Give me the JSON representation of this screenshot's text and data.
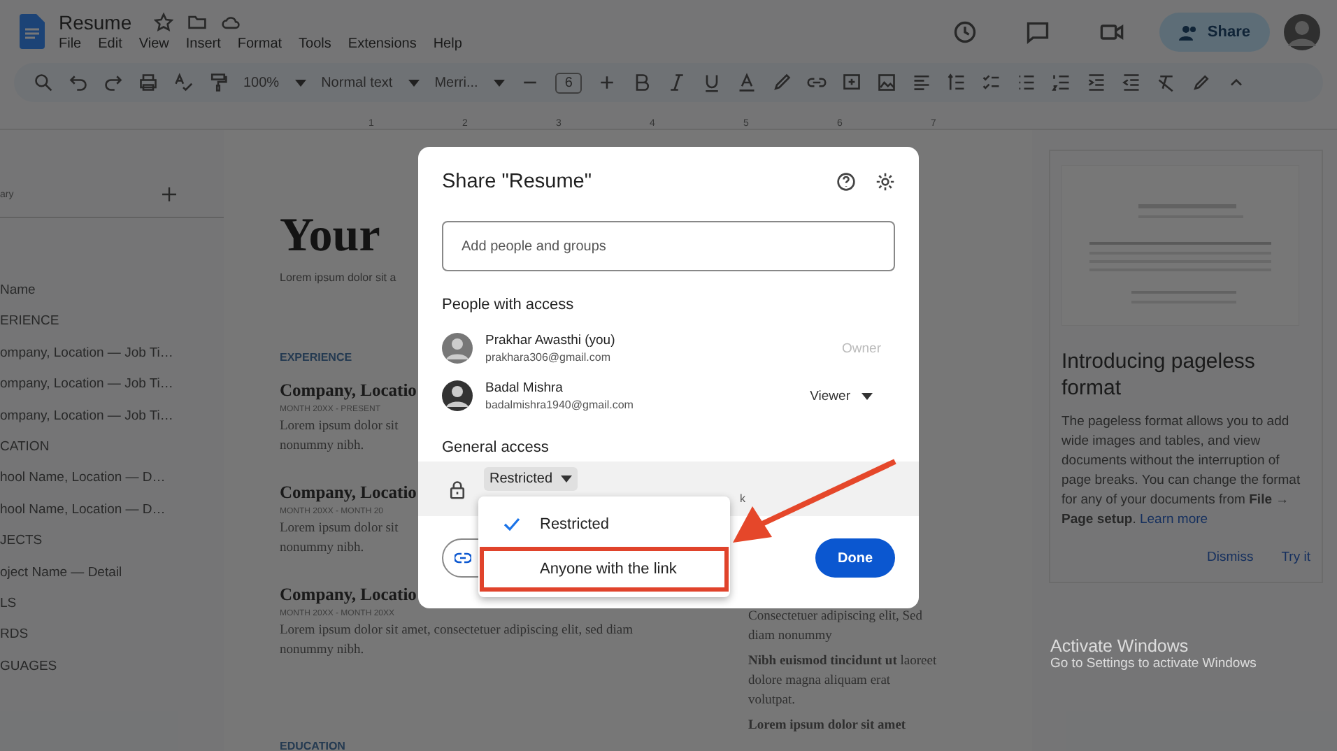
{
  "app": {
    "title": "Resume",
    "menus": [
      "File",
      "Edit",
      "View",
      "Insert",
      "Format",
      "Tools",
      "Extensions",
      "Help"
    ],
    "share_label": "Share"
  },
  "toolbar": {
    "zoom": "100%",
    "style": "Normal text",
    "font": "Merri...",
    "font_size": "6"
  },
  "ruler": {
    "numbers": [
      "1",
      "2",
      "3",
      "4",
      "5",
      "6",
      "7"
    ]
  },
  "outline": {
    "heading": "ary",
    "items": [
      "Name",
      "ERIENCE",
      "ompany, Location — Job Ti…",
      "ompany, Location — Job Ti…",
      "ompany, Location — Job Ti…",
      "CATION",
      "hool Name, Location — D…",
      "hool Name, Location — D…",
      "JECTS",
      "oject Name — Detail",
      "LS",
      "RDS",
      "GUAGES"
    ]
  },
  "document": {
    "title": "Your",
    "intro": "Lorem ipsum dolor sit a",
    "sections": [
      {
        "heading": "EXPERIENCE",
        "entries": [
          {
            "title": "Company, Locatio",
            "date": "MONTH 20XX - PRESENT",
            "body": [
              "Lorem ipsum dolor sit",
              "nonummy nibh."
            ]
          },
          {
            "title": "Company, Locatio",
            "date": "MONTH 20XX - MONTH 20",
            "body": [
              "Lorem ipsum dolor sit",
              "nonummy nibh."
            ]
          },
          {
            "title": "Company, Locatio",
            "date": "MONTH 20XX - MONTH 20XX",
            "body": [
              "Lorem ipsum dolor sit amet, consectetuer adipiscing elit, sed diam",
              "nonummy nibh."
            ]
          }
        ]
      },
      {
        "heading": "EDUCATION"
      }
    ],
    "side_column": [
      "Consectetuer adipiscing elit, Sed diam nonummy",
      "**Nibh euismod tincidunt ut** laoreet dolore magna aliquam erat volutpat.",
      "**Lorem ipsum dolor sit amet**"
    ]
  },
  "promo": {
    "title": "Introducing pageless format",
    "body": "The pageless format allows you to add wide images and tables, and view documents without the interruption of page breaks. You can change the format for any of your documents from **File → Page setup**.",
    "link": "Learn more",
    "actions": [
      "Dismiss",
      "Try it"
    ]
  },
  "system_notice": {
    "title": "Activate Windows",
    "subtitle": "Go to Settings to activate Windows"
  },
  "dialog": {
    "title": "Share \"Resume\"",
    "search": {
      "placeholder": "Add people and groups"
    },
    "people_heading": "People with access",
    "people": [
      {
        "name": "Prakhar Awasthi (you)",
        "email": "prakhara306@gmail.com",
        "role": "Owner",
        "editable": false
      },
      {
        "name": "Badal Mishra",
        "email": "badalmishra1940@gmail.com",
        "role": "Viewer",
        "editable": true
      }
    ],
    "general_heading": "General access",
    "access": {
      "value": "Restricted",
      "description": "k",
      "menu": [
        {
          "label": "Restricted",
          "selected": true,
          "highlighted": false
        },
        {
          "label": "Anyone with the link",
          "selected": false,
          "highlighted": true
        }
      ]
    },
    "done": "Done"
  }
}
